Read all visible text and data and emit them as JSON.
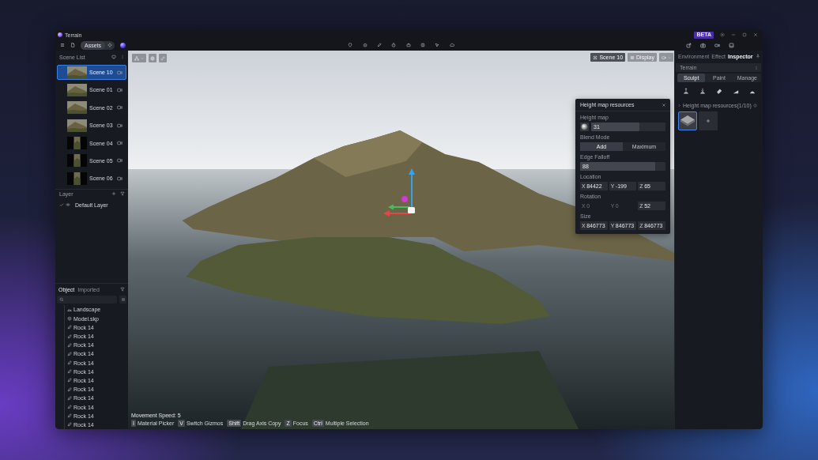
{
  "window": {
    "title": "Terrain",
    "badge": "BETA"
  },
  "toolbar": {
    "assets_label": "Assets"
  },
  "scene_list": {
    "title": "Scene List",
    "scenes": [
      {
        "name": "Scene 10",
        "selected": true,
        "kind": "landscape"
      },
      {
        "name": "Scene 01",
        "selected": false,
        "kind": "landscape"
      },
      {
        "name": "Scene 02",
        "selected": false,
        "kind": "landscape"
      },
      {
        "name": "Scene 03",
        "selected": false,
        "kind": "landscape"
      },
      {
        "name": "Scene 04",
        "selected": false,
        "kind": "portrait"
      },
      {
        "name": "Scene 05",
        "selected": false,
        "kind": "portrait"
      },
      {
        "name": "Scene 06",
        "selected": false,
        "kind": "portrait"
      }
    ]
  },
  "layers": {
    "title": "Layer",
    "items": [
      {
        "name": "Default Layer",
        "checked": true
      }
    ]
  },
  "objects": {
    "tabs": [
      {
        "label": "Object",
        "selected": true
      },
      {
        "label": "Imported",
        "selected": false
      }
    ],
    "items": [
      {
        "name": "Landscape",
        "kind": "landscape"
      },
      {
        "name": "Model.skp",
        "kind": "model"
      },
      {
        "name": "Rock 14",
        "kind": "rock"
      },
      {
        "name": "Rock 14",
        "kind": "rock"
      },
      {
        "name": "Rock 14",
        "kind": "rock"
      },
      {
        "name": "Rock 14",
        "kind": "rock"
      },
      {
        "name": "Rock 14",
        "kind": "rock"
      },
      {
        "name": "Rock 14",
        "kind": "rock"
      },
      {
        "name": "Rock 14",
        "kind": "rock"
      },
      {
        "name": "Rock 14",
        "kind": "rock"
      },
      {
        "name": "Rock 14",
        "kind": "rock"
      },
      {
        "name": "Rock 14",
        "kind": "rock"
      },
      {
        "name": "Rock 14",
        "kind": "rock"
      },
      {
        "name": "Rock 14",
        "kind": "rock"
      }
    ]
  },
  "viewport": {
    "scene_button": "Scene 10",
    "display_button": "Display",
    "movement_speed": "Movement Speed: 5",
    "shortcuts": [
      {
        "key": "I",
        "action": "Material Picker"
      },
      {
        "key": "V",
        "action": "Switch Gizmos"
      },
      {
        "key": "Shift",
        "action": "Drag Axis Copy"
      },
      {
        "key": "Z",
        "action": "Focus"
      },
      {
        "key": "Ctrl",
        "action": "Multiple Selection"
      }
    ]
  },
  "height_map_panel": {
    "title": "Height map resources",
    "height_map": {
      "label": "Height map",
      "value": "31",
      "level": 0.65
    },
    "blend_mode": {
      "label": "Blend Mode",
      "options": [
        {
          "label": "Add",
          "selected": true
        },
        {
          "label": "Maximum",
          "selected": false
        }
      ]
    },
    "edge_falloff": {
      "label": "Edge Falloff",
      "value": "88",
      "level": 0.88
    },
    "vectors": [
      {
        "label": "Location",
        "fields": [
          {
            "axis": "X",
            "value": "84422",
            "disabled": false
          },
          {
            "axis": "Y",
            "value": "-199",
            "disabled": false
          },
          {
            "axis": "Z",
            "value": "65",
            "disabled": false
          }
        ]
      },
      {
        "label": "Rotation",
        "fields": [
          {
            "axis": "X",
            "value": "0",
            "disabled": true
          },
          {
            "axis": "Y",
            "value": "0",
            "disabled": true
          },
          {
            "axis": "Z",
            "value": "52",
            "disabled": false
          }
        ]
      },
      {
        "label": "Size",
        "fields": [
          {
            "axis": "X",
            "value": "846773",
            "disabled": false
          },
          {
            "axis": "Y",
            "value": "846773",
            "disabled": false
          },
          {
            "axis": "Z",
            "value": "846773",
            "disabled": false
          }
        ]
      }
    ]
  },
  "inspector": {
    "tabs": [
      {
        "label": "Environment",
        "selected": false
      },
      {
        "label": "Effect",
        "selected": false
      },
      {
        "label": "Inspector",
        "selected": true
      }
    ],
    "header": "Terrain",
    "modes": [
      {
        "label": "Sculpt",
        "selected": true
      },
      {
        "label": "Paint",
        "selected": false
      },
      {
        "label": "Manage",
        "selected": false
      }
    ],
    "resources": {
      "title": "Height map resources(1/10)",
      "thumbnails": [
        {
          "selected": true
        }
      ]
    }
  }
}
